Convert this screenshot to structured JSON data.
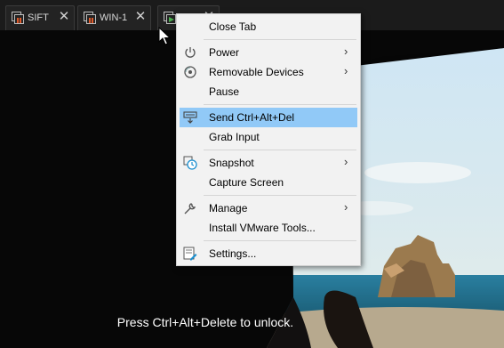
{
  "tabs": [
    {
      "label": "SIFT",
      "close": "✕",
      "state": "off"
    },
    {
      "label": "WIN-1",
      "close": "✕",
      "state": "off"
    },
    {
      "label": "",
      "close": "✕",
      "state": "running"
    }
  ],
  "lock_screen": {
    "message": "Press Ctrl+Alt+Delete to unlock."
  },
  "context_menu": {
    "items": [
      {
        "label": "Close Tab",
        "icon": "none",
        "submenu": false
      },
      {
        "label": "Power",
        "icon": "power-icon",
        "submenu": true,
        "arrow": "›"
      },
      {
        "label": "Removable Devices",
        "icon": "removable-devices-icon",
        "submenu": true,
        "arrow": "›"
      },
      {
        "label": "Pause",
        "icon": "none",
        "submenu": false
      },
      {
        "label": "Send Ctrl+Alt+Del",
        "icon": "send-keys-icon",
        "submenu": false,
        "highlighted": true
      },
      {
        "label": "Grab Input",
        "icon": "none",
        "submenu": false
      },
      {
        "label": "Snapshot",
        "icon": "snapshot-icon",
        "submenu": true,
        "arrow": "›"
      },
      {
        "label": "Capture Screen",
        "icon": "none",
        "submenu": false
      },
      {
        "label": "Manage",
        "icon": "wrench-icon",
        "submenu": true,
        "arrow": "›"
      },
      {
        "label": "Install VMware Tools...",
        "icon": "none",
        "submenu": false
      },
      {
        "label": "Settings...",
        "icon": "settings-icon",
        "submenu": false
      }
    ]
  },
  "colors": {
    "highlight": "#91c9f7",
    "menu_bg": "#f2f2f2",
    "tab_bg": "#232323",
    "vm_off": "#e05a2a",
    "vm_running": "#4caf50"
  }
}
